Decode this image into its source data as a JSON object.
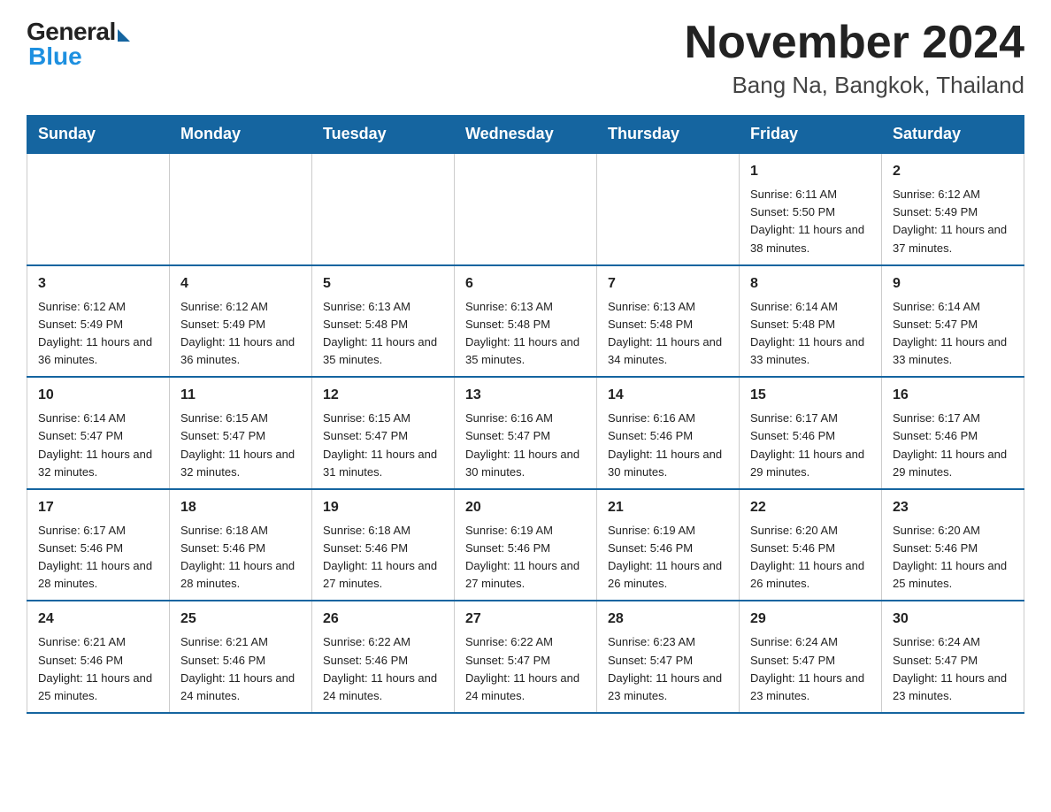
{
  "logo": {
    "general": "General",
    "blue": "Blue"
  },
  "title": "November 2024",
  "subtitle": "Bang Na, Bangkok, Thailand",
  "weekdays": [
    "Sunday",
    "Monday",
    "Tuesday",
    "Wednesday",
    "Thursday",
    "Friday",
    "Saturday"
  ],
  "weeks": [
    [
      {
        "day": "",
        "sunrise": "",
        "sunset": "",
        "daylight": ""
      },
      {
        "day": "",
        "sunrise": "",
        "sunset": "",
        "daylight": ""
      },
      {
        "day": "",
        "sunrise": "",
        "sunset": "",
        "daylight": ""
      },
      {
        "day": "",
        "sunrise": "",
        "sunset": "",
        "daylight": ""
      },
      {
        "day": "",
        "sunrise": "",
        "sunset": "",
        "daylight": ""
      },
      {
        "day": "1",
        "sunrise": "Sunrise: 6:11 AM",
        "sunset": "Sunset: 5:50 PM",
        "daylight": "Daylight: 11 hours and 38 minutes."
      },
      {
        "day": "2",
        "sunrise": "Sunrise: 6:12 AM",
        "sunset": "Sunset: 5:49 PM",
        "daylight": "Daylight: 11 hours and 37 minutes."
      }
    ],
    [
      {
        "day": "3",
        "sunrise": "Sunrise: 6:12 AM",
        "sunset": "Sunset: 5:49 PM",
        "daylight": "Daylight: 11 hours and 36 minutes."
      },
      {
        "day": "4",
        "sunrise": "Sunrise: 6:12 AM",
        "sunset": "Sunset: 5:49 PM",
        "daylight": "Daylight: 11 hours and 36 minutes."
      },
      {
        "day": "5",
        "sunrise": "Sunrise: 6:13 AM",
        "sunset": "Sunset: 5:48 PM",
        "daylight": "Daylight: 11 hours and 35 minutes."
      },
      {
        "day": "6",
        "sunrise": "Sunrise: 6:13 AM",
        "sunset": "Sunset: 5:48 PM",
        "daylight": "Daylight: 11 hours and 35 minutes."
      },
      {
        "day": "7",
        "sunrise": "Sunrise: 6:13 AM",
        "sunset": "Sunset: 5:48 PM",
        "daylight": "Daylight: 11 hours and 34 minutes."
      },
      {
        "day": "8",
        "sunrise": "Sunrise: 6:14 AM",
        "sunset": "Sunset: 5:48 PM",
        "daylight": "Daylight: 11 hours and 33 minutes."
      },
      {
        "day": "9",
        "sunrise": "Sunrise: 6:14 AM",
        "sunset": "Sunset: 5:47 PM",
        "daylight": "Daylight: 11 hours and 33 minutes."
      }
    ],
    [
      {
        "day": "10",
        "sunrise": "Sunrise: 6:14 AM",
        "sunset": "Sunset: 5:47 PM",
        "daylight": "Daylight: 11 hours and 32 minutes."
      },
      {
        "day": "11",
        "sunrise": "Sunrise: 6:15 AM",
        "sunset": "Sunset: 5:47 PM",
        "daylight": "Daylight: 11 hours and 32 minutes."
      },
      {
        "day": "12",
        "sunrise": "Sunrise: 6:15 AM",
        "sunset": "Sunset: 5:47 PM",
        "daylight": "Daylight: 11 hours and 31 minutes."
      },
      {
        "day": "13",
        "sunrise": "Sunrise: 6:16 AM",
        "sunset": "Sunset: 5:47 PM",
        "daylight": "Daylight: 11 hours and 30 minutes."
      },
      {
        "day": "14",
        "sunrise": "Sunrise: 6:16 AM",
        "sunset": "Sunset: 5:46 PM",
        "daylight": "Daylight: 11 hours and 30 minutes."
      },
      {
        "day": "15",
        "sunrise": "Sunrise: 6:17 AM",
        "sunset": "Sunset: 5:46 PM",
        "daylight": "Daylight: 11 hours and 29 minutes."
      },
      {
        "day": "16",
        "sunrise": "Sunrise: 6:17 AM",
        "sunset": "Sunset: 5:46 PM",
        "daylight": "Daylight: 11 hours and 29 minutes."
      }
    ],
    [
      {
        "day": "17",
        "sunrise": "Sunrise: 6:17 AM",
        "sunset": "Sunset: 5:46 PM",
        "daylight": "Daylight: 11 hours and 28 minutes."
      },
      {
        "day": "18",
        "sunrise": "Sunrise: 6:18 AM",
        "sunset": "Sunset: 5:46 PM",
        "daylight": "Daylight: 11 hours and 28 minutes."
      },
      {
        "day": "19",
        "sunrise": "Sunrise: 6:18 AM",
        "sunset": "Sunset: 5:46 PM",
        "daylight": "Daylight: 11 hours and 27 minutes."
      },
      {
        "day": "20",
        "sunrise": "Sunrise: 6:19 AM",
        "sunset": "Sunset: 5:46 PM",
        "daylight": "Daylight: 11 hours and 27 minutes."
      },
      {
        "day": "21",
        "sunrise": "Sunrise: 6:19 AM",
        "sunset": "Sunset: 5:46 PM",
        "daylight": "Daylight: 11 hours and 26 minutes."
      },
      {
        "day": "22",
        "sunrise": "Sunrise: 6:20 AM",
        "sunset": "Sunset: 5:46 PM",
        "daylight": "Daylight: 11 hours and 26 minutes."
      },
      {
        "day": "23",
        "sunrise": "Sunrise: 6:20 AM",
        "sunset": "Sunset: 5:46 PM",
        "daylight": "Daylight: 11 hours and 25 minutes."
      }
    ],
    [
      {
        "day": "24",
        "sunrise": "Sunrise: 6:21 AM",
        "sunset": "Sunset: 5:46 PM",
        "daylight": "Daylight: 11 hours and 25 minutes."
      },
      {
        "day": "25",
        "sunrise": "Sunrise: 6:21 AM",
        "sunset": "Sunset: 5:46 PM",
        "daylight": "Daylight: 11 hours and 24 minutes."
      },
      {
        "day": "26",
        "sunrise": "Sunrise: 6:22 AM",
        "sunset": "Sunset: 5:46 PM",
        "daylight": "Daylight: 11 hours and 24 minutes."
      },
      {
        "day": "27",
        "sunrise": "Sunrise: 6:22 AM",
        "sunset": "Sunset: 5:47 PM",
        "daylight": "Daylight: 11 hours and 24 minutes."
      },
      {
        "day": "28",
        "sunrise": "Sunrise: 6:23 AM",
        "sunset": "Sunset: 5:47 PM",
        "daylight": "Daylight: 11 hours and 23 minutes."
      },
      {
        "day": "29",
        "sunrise": "Sunrise: 6:24 AM",
        "sunset": "Sunset: 5:47 PM",
        "daylight": "Daylight: 11 hours and 23 minutes."
      },
      {
        "day": "30",
        "sunrise": "Sunrise: 6:24 AM",
        "sunset": "Sunset: 5:47 PM",
        "daylight": "Daylight: 11 hours and 23 minutes."
      }
    ]
  ]
}
